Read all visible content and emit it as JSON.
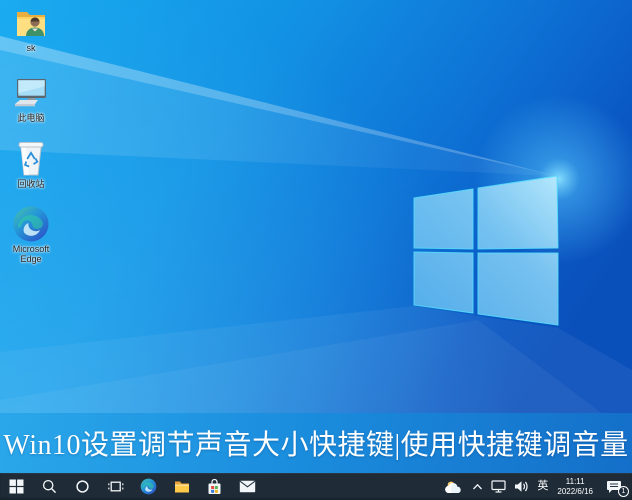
{
  "caption": {
    "text": "Win10设置调节声音大小快捷键|使用快捷键调音量"
  },
  "desktop": {
    "icons": [
      {
        "name": "user-folder",
        "label": "sk",
        "icon": "user-folder-icon"
      },
      {
        "name": "this-pc",
        "label": "此电脑",
        "icon": "computer-icon"
      },
      {
        "name": "recycle-bin",
        "label": "回收站",
        "icon": "recycle-bin-icon"
      },
      {
        "name": "edge-shortcut",
        "label": "Microsoft Edge",
        "icon": "edge-icon"
      }
    ]
  },
  "taskbar": {
    "buttons": [
      {
        "name": "start",
        "icon": "windows-logo-icon"
      },
      {
        "name": "search",
        "icon": "search-icon"
      },
      {
        "name": "cortana",
        "icon": "cortana-circle-icon"
      },
      {
        "name": "task-view",
        "icon": "task-view-icon"
      },
      {
        "name": "edge",
        "icon": "edge-icon"
      },
      {
        "name": "file-explorer",
        "icon": "folder-icon"
      },
      {
        "name": "store",
        "icon": "store-bag-icon"
      },
      {
        "name": "mail",
        "icon": "mail-envelope-icon"
      }
    ],
    "tray": {
      "weather_icon": "weather-cloud-icon",
      "chevron_icon": "chevron-up-icon",
      "network_icon": "network-display-icon",
      "volume_icon": "volume-speaker-icon",
      "ime_label": "英",
      "clock": {
        "time": "11:11",
        "date": "2022/6/16"
      },
      "action_center": {
        "icon": "action-center-icon",
        "badge_count": "1"
      }
    }
  },
  "colors": {
    "wallpaper_top_left": "#18aaf0",
    "wallpaper_bottom_right": "#0a50bb",
    "caption_left": "#2aa7ea",
    "caption_right": "#146fc9",
    "taskbar_bg": "#1f2c38",
    "logo_edge": "#54dcfc"
  }
}
